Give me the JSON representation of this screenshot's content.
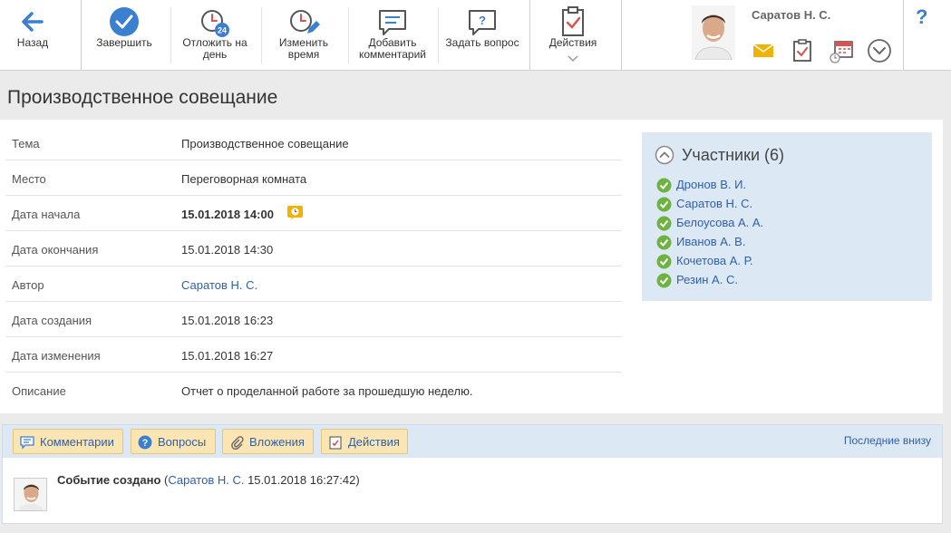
{
  "toolbar": {
    "back": "Назад",
    "complete": "Завершить",
    "postpone": "Отложить на день",
    "postpone_badge": "24",
    "change_time": "Изменить время",
    "add_comment": "Добавить комментарий",
    "ask_question": "Задать вопрос",
    "actions": "Действия"
  },
  "user": {
    "name": "Саратов Н. С."
  },
  "help": "?",
  "page_title": "Производственное совещание",
  "properties": [
    {
      "key": "Тема",
      "value": "Производственное совещание"
    },
    {
      "key": "Место",
      "value": "Переговорная комната"
    },
    {
      "key": "Дата начала",
      "value": "15.01.2018 14:00"
    },
    {
      "key": "Дата окончания",
      "value": "15.01.2018 14:30"
    },
    {
      "key": "Автор",
      "value": "Саратов Н. С."
    },
    {
      "key": "Дата создания",
      "value": "15.01.2018 16:23"
    },
    {
      "key": "Дата изменения",
      "value": "15.01.2018 16:27"
    },
    {
      "key": "Описание",
      "value": "Отчет о проделанной работе за прошедшую неделю."
    }
  ],
  "participants": {
    "title": "Участники (6)",
    "items": [
      "Дронов В. И.",
      "Саратов Н. С.",
      "Белоусова А. А.",
      "Иванов А. В.",
      "Кочетова А. Р.",
      "Резин А. С."
    ]
  },
  "tabs": {
    "comments": "Комментарии",
    "questions": "Вопросы",
    "attachments": "Вложения",
    "actions": "Действия",
    "sort": "Последние внизу"
  },
  "event": {
    "text": "Событие создано",
    "open": " (",
    "author": "Саратов Н. С.",
    "time": " 15.01.2018 16:27:42)"
  },
  "colors": {
    "accent": "#3a7fd0",
    "link": "#2e5fa8",
    "panel": "#dce9f5",
    "tab": "#fbe6b3",
    "check": "#6cb33f"
  }
}
